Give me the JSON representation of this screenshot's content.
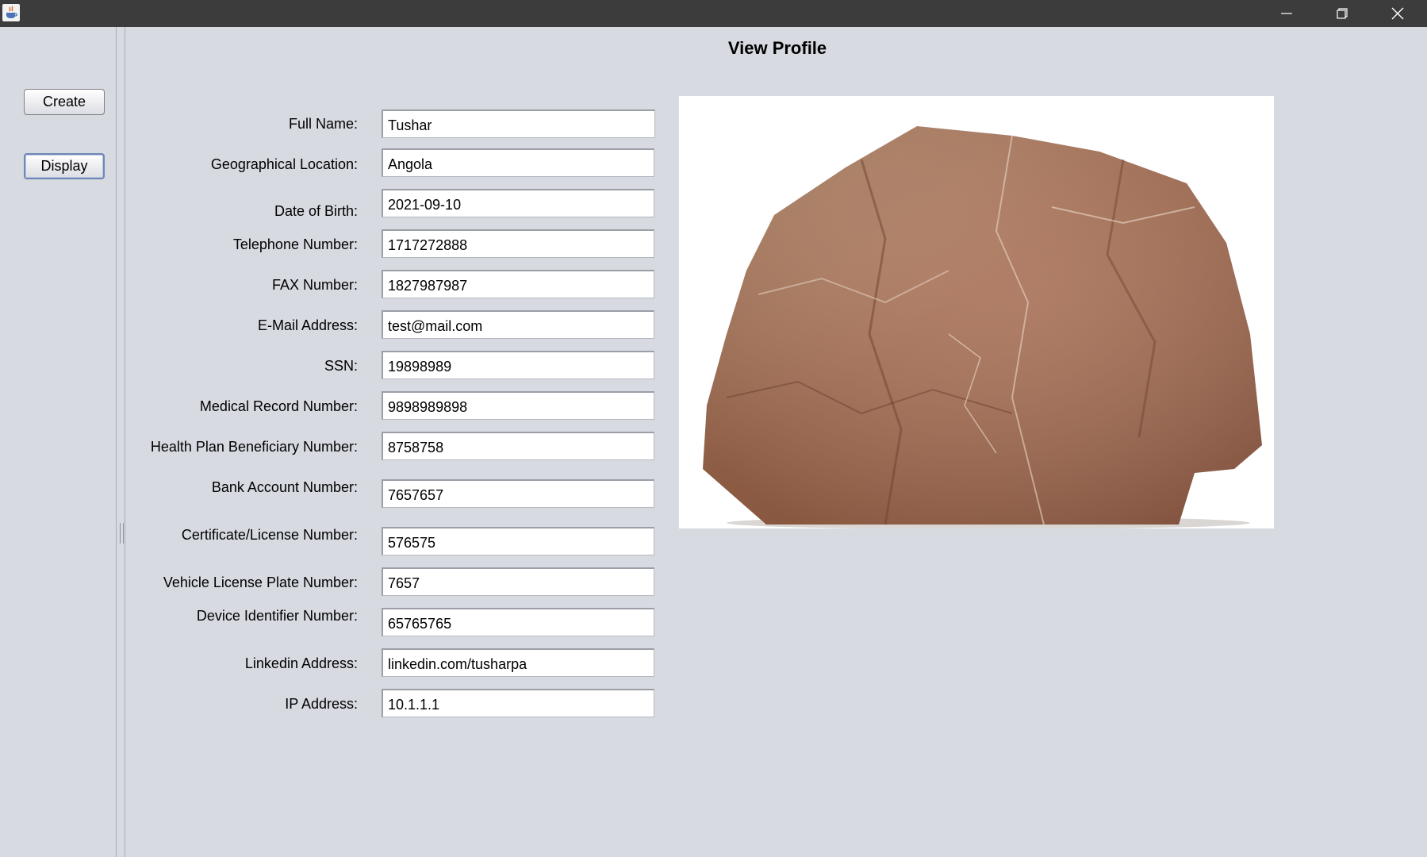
{
  "window": {
    "title": ""
  },
  "sidebar": {
    "create_label": "Create",
    "display_label": "Display"
  },
  "page": {
    "title": "View Profile"
  },
  "fields": [
    {
      "label": "Full Name:",
      "value": "Tushar"
    },
    {
      "label": "Geographical Location:",
      "value": " Angola"
    },
    {
      "label": "Date of Birth:",
      "value": "2021-09-10"
    },
    {
      "label": "Telephone Number:",
      "value": "1717272888"
    },
    {
      "label": "FAX Number:",
      "value": "1827987987"
    },
    {
      "label": "E-Mail Address:",
      "value": "test@mail.com"
    },
    {
      "label": "SSN:",
      "value": "19898989"
    },
    {
      "label": "Medical Record Number:",
      "value": "9898989898"
    },
    {
      "label": "Health Plan Beneficiary Number:",
      "value": "8758758"
    },
    {
      "label": "Bank Account Number:",
      "value": "7657657"
    },
    {
      "label": "Certificate/License Number:",
      "value": "576575"
    },
    {
      "label": "Vehicle License Plate Number:",
      "value": "7657"
    },
    {
      "label": "Device Identifier Number:",
      "value": "65765765"
    },
    {
      "label": "Linkedin Address:",
      "value": "linkedin.com/tusharpa"
    },
    {
      "label": "IP Address:",
      "value": "10.1.1.1"
    }
  ],
  "icons": {
    "app": "java-app-icon",
    "minimize": "minimize-icon",
    "maximize": "restore-icon",
    "close": "close-icon"
  },
  "colors": {
    "background": "#d7dae1",
    "titlebar": "#3c3c3c",
    "focus_border": "#6f87b5"
  }
}
